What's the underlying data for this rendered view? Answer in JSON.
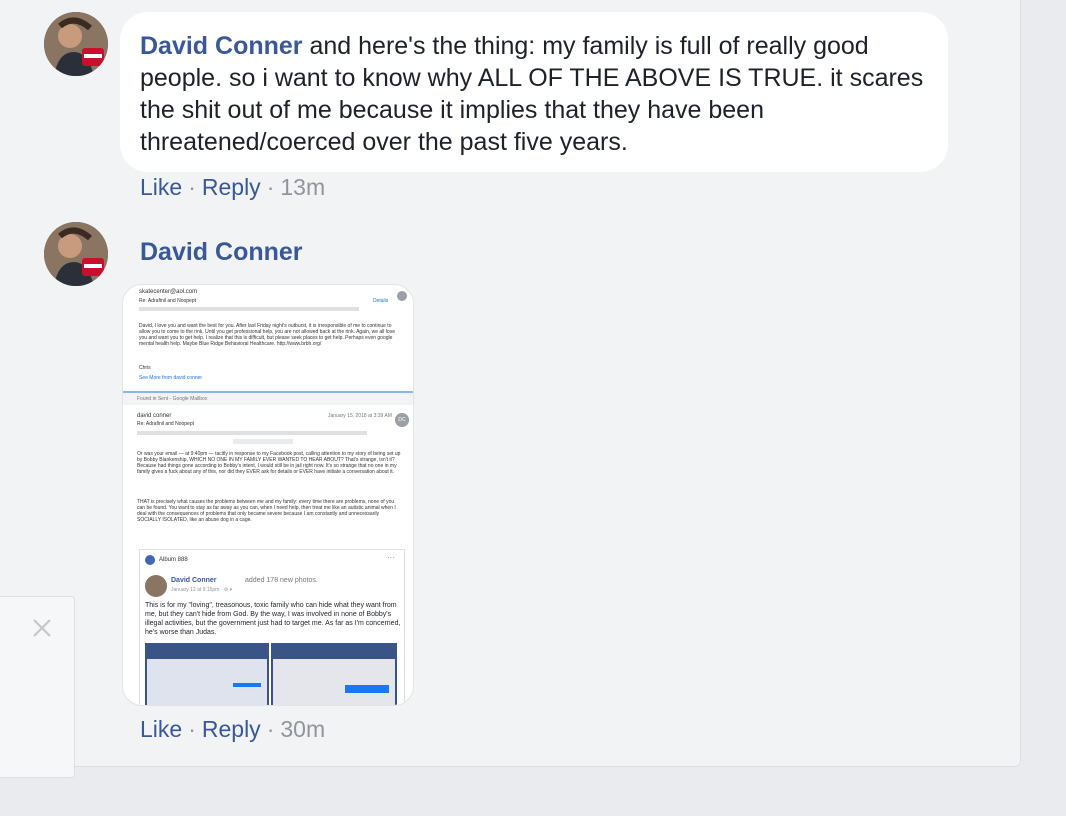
{
  "comments": [
    {
      "author": "David Conner",
      "text": "and here's the thing: my family is full of really good people. so i want to know why ALL OF THE ABOVE IS TRUE. it scares the shit out of me because it implies that they have been threatened/coerced over the past five years.",
      "like": "Like",
      "reply": "Reply",
      "time": "13m"
    },
    {
      "author": "David Conner",
      "like": "Like",
      "reply": "Reply",
      "time": "30m",
      "attachment": {
        "email1_from": "skatecenter@aol.com",
        "email1_subject": "Re: Adrafinil and Noopept",
        "email1_details": "Details",
        "email1_body": "David, I love you and want the best for you. After last Friday night's outburst, it is irresponsible of me to continue to allow you to come to the rink. Until you get professional help, you are not allowed back at the rink. Again, we all love you and want you to get help. I realize that this is difficult, but please seek places to get help. Perhaps even google mental health help. Maybe Blue Ridge Behavioral Healthcare. http://www.brbh.org/",
        "email1_sign": "Chris",
        "email1_more": "See More from david conner",
        "found_in": "Found in Sent - Google Mailbox",
        "email2_from": "david conner",
        "email2_date": "January 15, 2018 at 3:39 AM",
        "email2_subject": "Re: Adrafinil and Noopept",
        "email2_initials": "DC",
        "email2_body1": "Or was your email — at 9:40pm — tacitly in response to my Facebook post, calling attention to my story of being set up by Bobby Blankenship, WHICH NO ONE IN MY FAMILY EVER WANTED TO HEAR ABOUT? That's strange, isn't it? Because had things gone according to Bobby's intent, I would still be in jail right now. It's so strange that no one in my family gives a fuck about any of this, nor did they EVER ask for details or EVER have initiate a conversation about it.",
        "email2_body2": "THAT is precisely what causes the problems between me and my family: every time there are problems, none of you can be found. You want to stay as far away as you can, when I need help, then treat me like an autistic animal when I deal with the consequences of problems that only became severe because I am constantly and unnecessarily SOCIALLY ISOLATED, like an abuse dog in a cage.",
        "album_title": "Album 888",
        "post_author": "David Conner",
        "post_added": "added 178 new photos.",
        "post_time": "January 12 at 9:15pm · ⚙ ▾",
        "post_text": "This is for my \"loving\", treasonous, toxic family who can hide what they want from me, but they can't hide from God. By the way, I was involved in none of Bobby's illegal activities, but the government just had to target me. As far as I'm concerned, he's worse than Judas."
      }
    }
  ],
  "colors": {
    "link": "#385898",
    "meta": "#90949c",
    "background": "#e9ebee",
    "bubble": "#ffffff"
  }
}
